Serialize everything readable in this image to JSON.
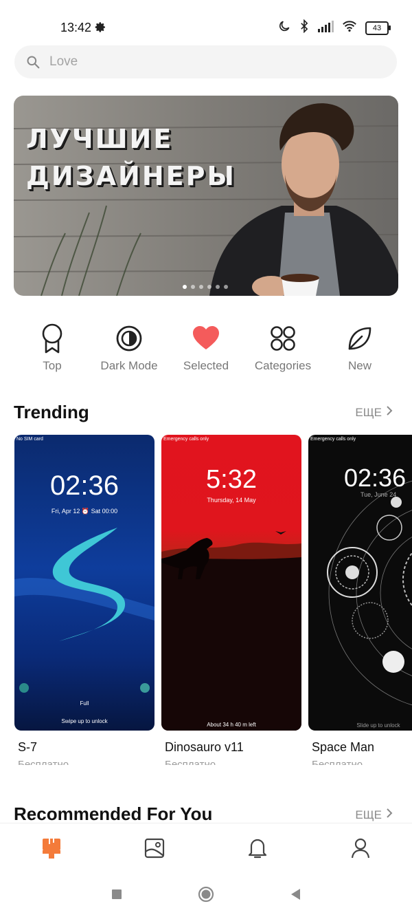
{
  "status_bar": {
    "time": "13:42",
    "battery": "43"
  },
  "search": {
    "placeholder": "Love"
  },
  "banner": {
    "title": "ЛУЧШИЕ\nДИЗАЙНЕРЫ",
    "page_count": 6,
    "active_page": 1
  },
  "quick_links": [
    {
      "label": "Top",
      "icon": "ribbon-icon"
    },
    {
      "label": "Dark Mode",
      "icon": "half-circle-icon"
    },
    {
      "label": "Selected",
      "icon": "heart-icon"
    },
    {
      "label": "Categories",
      "icon": "grid-icon"
    },
    {
      "label": "New",
      "icon": "leaf-icon"
    }
  ],
  "trending": {
    "title": "Trending",
    "more_label": "ЕЩЕ",
    "items": [
      {
        "name": "S-7",
        "price": "Бесплатно",
        "preview": {
          "carrier": "No SIM card",
          "clock": "02:36",
          "date": "Fri, Apr 12  ⏰ Sat 00:00",
          "small": "Full",
          "hint": "Swipe up to unlock"
        }
      },
      {
        "name": "Dinosauro v11",
        "price": "Бесплатно",
        "preview": {
          "carrier": "Emergency calls only",
          "clock": "5:32",
          "date": "Thursday, 14 May",
          "hint": "About 34 h 40 m left"
        }
      },
      {
        "name": "Space Man",
        "price": "Бесплатно",
        "preview": {
          "carrier": "Emergency calls only",
          "clock": "02:36",
          "date": "Tue, June 24",
          "hint": "Slide up to unlock"
        }
      }
    ]
  },
  "recommended": {
    "title": "Recommended For You",
    "more_label": "ЕЩЕ"
  },
  "colors": {
    "accent": "#f47b3a",
    "heart": "#f45b5b"
  }
}
